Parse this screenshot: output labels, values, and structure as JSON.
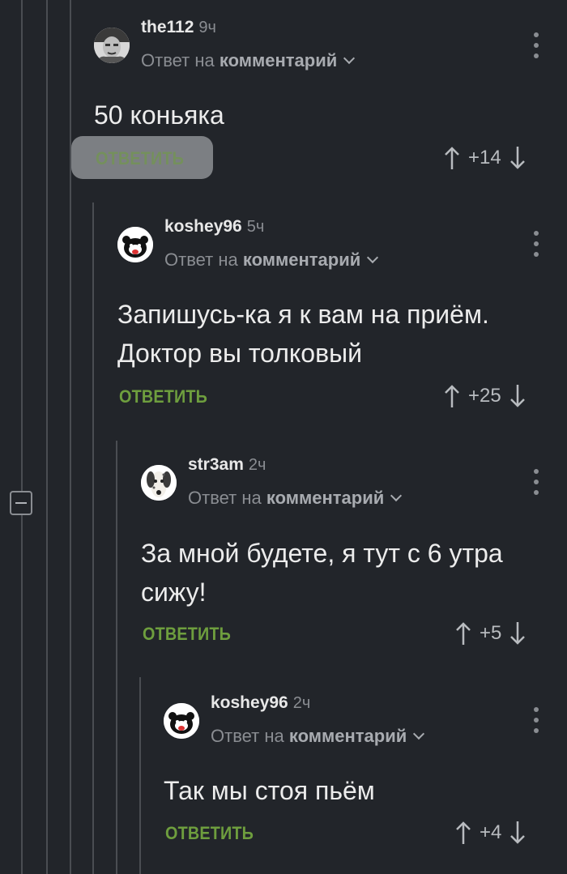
{
  "comments": [
    {
      "username": "the112",
      "time": "9ч",
      "reply_prefix": "Ответ на",
      "reply_target": "комментарий",
      "text_lines": [
        "50 коньяка"
      ],
      "reply_label": "ОТВЕТИТЬ",
      "score": "+14"
    },
    {
      "username": "koshey96",
      "time": "5ч",
      "reply_prefix": "Ответ на",
      "reply_target": "комментарий",
      "text_lines": [
        "Запишусь-ка я к вам на приём.",
        "Доктор вы толковый"
      ],
      "reply_label": "ОТВЕТИТЬ",
      "score": "+25"
    },
    {
      "username": "str3am",
      "time": "2ч",
      "reply_prefix": "Ответ на",
      "reply_target": "комментарий",
      "text_lines": [
        "За мной будете, я тут с 6 утра",
        "сижу!"
      ],
      "reply_label": "ОТВЕТИТЬ",
      "score": "+5"
    },
    {
      "username": "koshey96",
      "time": "2ч",
      "reply_prefix": "Ответ на",
      "reply_target": "комментарий",
      "text_lines": [
        "Так мы стоя пьём"
      ],
      "reply_label": "ОТВЕТИТЬ",
      "score": "+4"
    }
  ],
  "colors": {
    "background": "#22252a",
    "reply_button": "#6e9e3e",
    "thread_line": "#4a4d52"
  },
  "icons": {
    "vote_up": "arrow-up-icon",
    "vote_down": "arrow-down-icon",
    "menu": "more-vertical-icon",
    "collapse": "collapse-thread-icon",
    "reply_dropdown": "chevron-down-icon"
  }
}
